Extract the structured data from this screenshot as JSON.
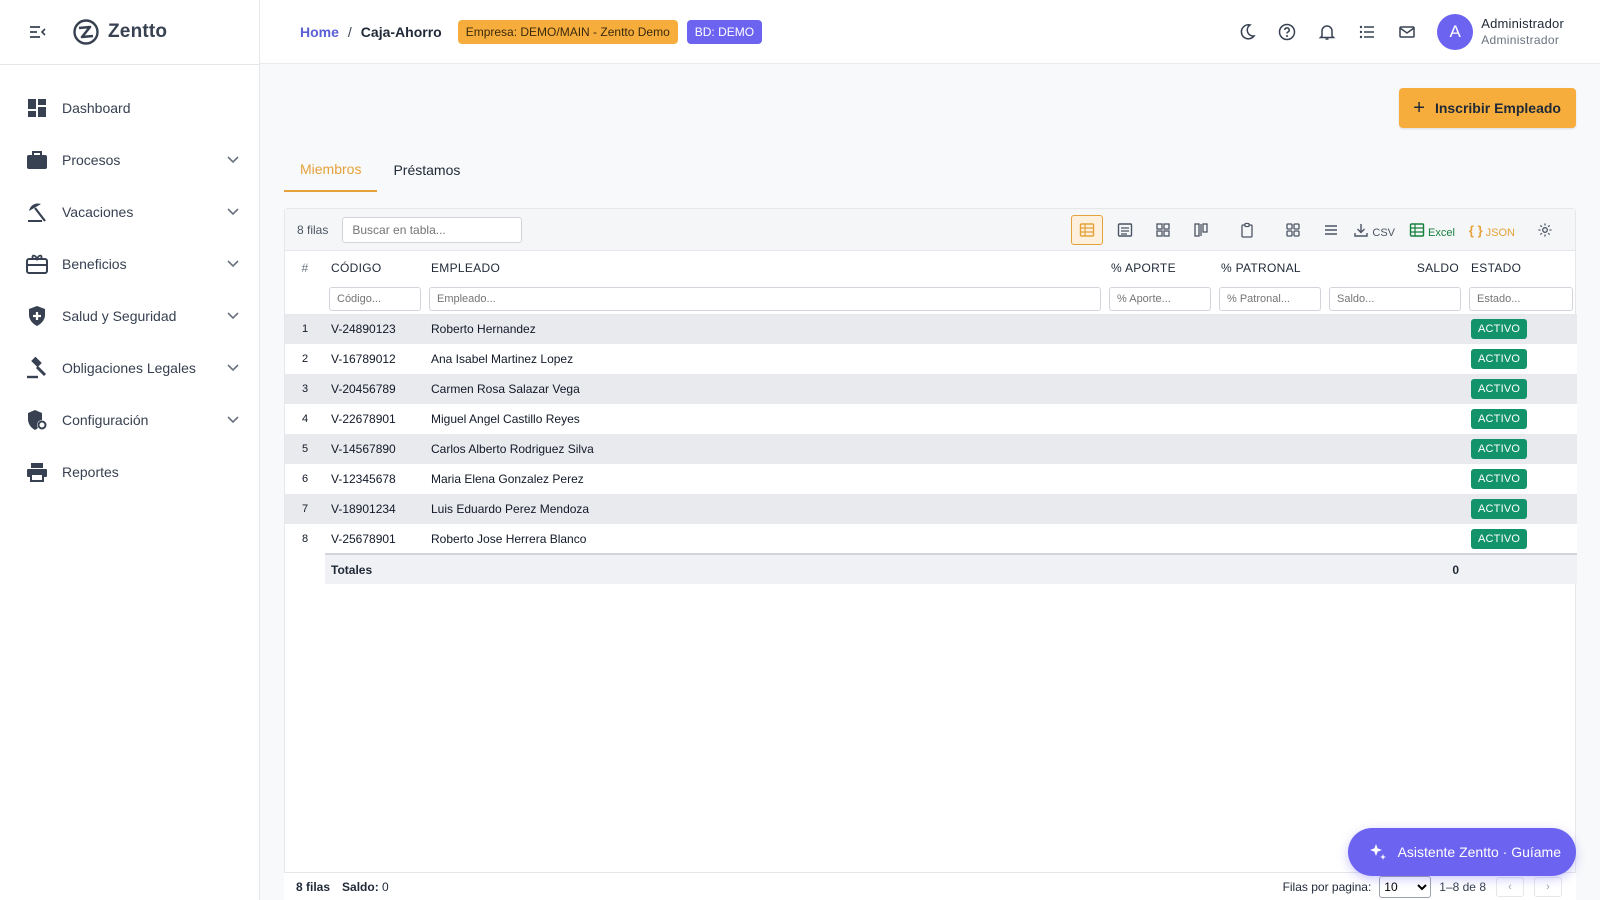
{
  "brand": {
    "name": "Zentto"
  },
  "sidebar": {
    "items": [
      {
        "label": "Dashboard",
        "icon": "dashboard-icon",
        "expandable": false
      },
      {
        "label": "Procesos",
        "icon": "briefcase-icon",
        "expandable": true
      },
      {
        "label": "Vacaciones",
        "icon": "beach-umbrella-icon",
        "expandable": true
      },
      {
        "label": "Beneficios",
        "icon": "gift-card-icon",
        "expandable": true
      },
      {
        "label": "Salud y Seguridad",
        "icon": "shield-plus-icon",
        "expandable": true
      },
      {
        "label": "Obligaciones Legales",
        "icon": "gavel-icon",
        "expandable": true
      },
      {
        "label": "Configuración",
        "icon": "shield-gear-icon",
        "expandable": true
      },
      {
        "label": "Reportes",
        "icon": "printer-icon",
        "expandable": false
      }
    ]
  },
  "header": {
    "breadcrumb": {
      "home": "Home",
      "separator": "/",
      "current": "Caja-Ahorro"
    },
    "company_chip": "Empresa: DEMO/MAIN - Zentto Demo",
    "db_chip": "BD: DEMO",
    "user": {
      "initial": "A",
      "name": "Administrador",
      "role": "Administrador"
    }
  },
  "actions": {
    "enroll_label": "Inscribir Empleado"
  },
  "tabs": [
    {
      "label": "Miembros",
      "active": true
    },
    {
      "label": "Préstamos",
      "active": false
    }
  ],
  "toolbar": {
    "rows_count": "8 filas",
    "search_placeholder": "Buscar en tabla...",
    "csv_label": "CSV",
    "excel_label": "Excel",
    "json_label": "JSON"
  },
  "table": {
    "columns": {
      "num": "#",
      "code": "CÓDIGO",
      "employee": "EMPLEADO",
      "aporte": "% APORTE",
      "patronal": "% PATRONAL",
      "saldo": "SALDO",
      "estado": "ESTADO"
    },
    "filters": {
      "code": "Código...",
      "employee": "Empleado...",
      "aporte": "% Aporte...",
      "patronal": "% Patronal...",
      "saldo": "Saldo...",
      "estado": "Estado..."
    },
    "rows": [
      {
        "num": "1",
        "code": "V-24890123",
        "employee": "Roberto Hernandez",
        "aporte": "",
        "patronal": "",
        "saldo": "",
        "estado": "ACTIVO"
      },
      {
        "num": "2",
        "code": "V-16789012",
        "employee": "Ana Isabel Martinez Lopez",
        "aporte": "",
        "patronal": "",
        "saldo": "",
        "estado": "ACTIVO"
      },
      {
        "num": "3",
        "code": "V-20456789",
        "employee": "Carmen Rosa Salazar Vega",
        "aporte": "",
        "patronal": "",
        "saldo": "",
        "estado": "ACTIVO"
      },
      {
        "num": "4",
        "code": "V-22678901",
        "employee": "Miguel Angel Castillo Reyes",
        "aporte": "",
        "patronal": "",
        "saldo": "",
        "estado": "ACTIVO"
      },
      {
        "num": "5",
        "code": "V-14567890",
        "employee": "Carlos Alberto Rodriguez Silva",
        "aporte": "",
        "patronal": "",
        "saldo": "",
        "estado": "ACTIVO"
      },
      {
        "num": "6",
        "code": "V-12345678",
        "employee": "Maria Elena Gonzalez Perez",
        "aporte": "",
        "patronal": "",
        "saldo": "",
        "estado": "ACTIVO"
      },
      {
        "num": "7",
        "code": "V-18901234",
        "employee": "Luis Eduardo Perez Mendoza",
        "aporte": "",
        "patronal": "",
        "saldo": "",
        "estado": "ACTIVO"
      },
      {
        "num": "8",
        "code": "V-25678901",
        "employee": "Roberto Jose Herrera Blanco",
        "aporte": "",
        "patronal": "",
        "saldo": "",
        "estado": "ACTIVO"
      }
    ],
    "totals": {
      "label": "Totales",
      "saldo": "0"
    }
  },
  "footer": {
    "rows_count": "8 filas",
    "saldo_label": "Saldo:",
    "saldo_value": "0",
    "rows_per_page_label": "Filas por pagina:",
    "rows_per_page": "10",
    "range": "1–8 de 8"
  },
  "assistant": {
    "label": "Asistente Zentto · Guíame"
  },
  "colors": {
    "accent": "#f6ad3c",
    "primary": "#6c63f0",
    "success": "#12936a"
  }
}
